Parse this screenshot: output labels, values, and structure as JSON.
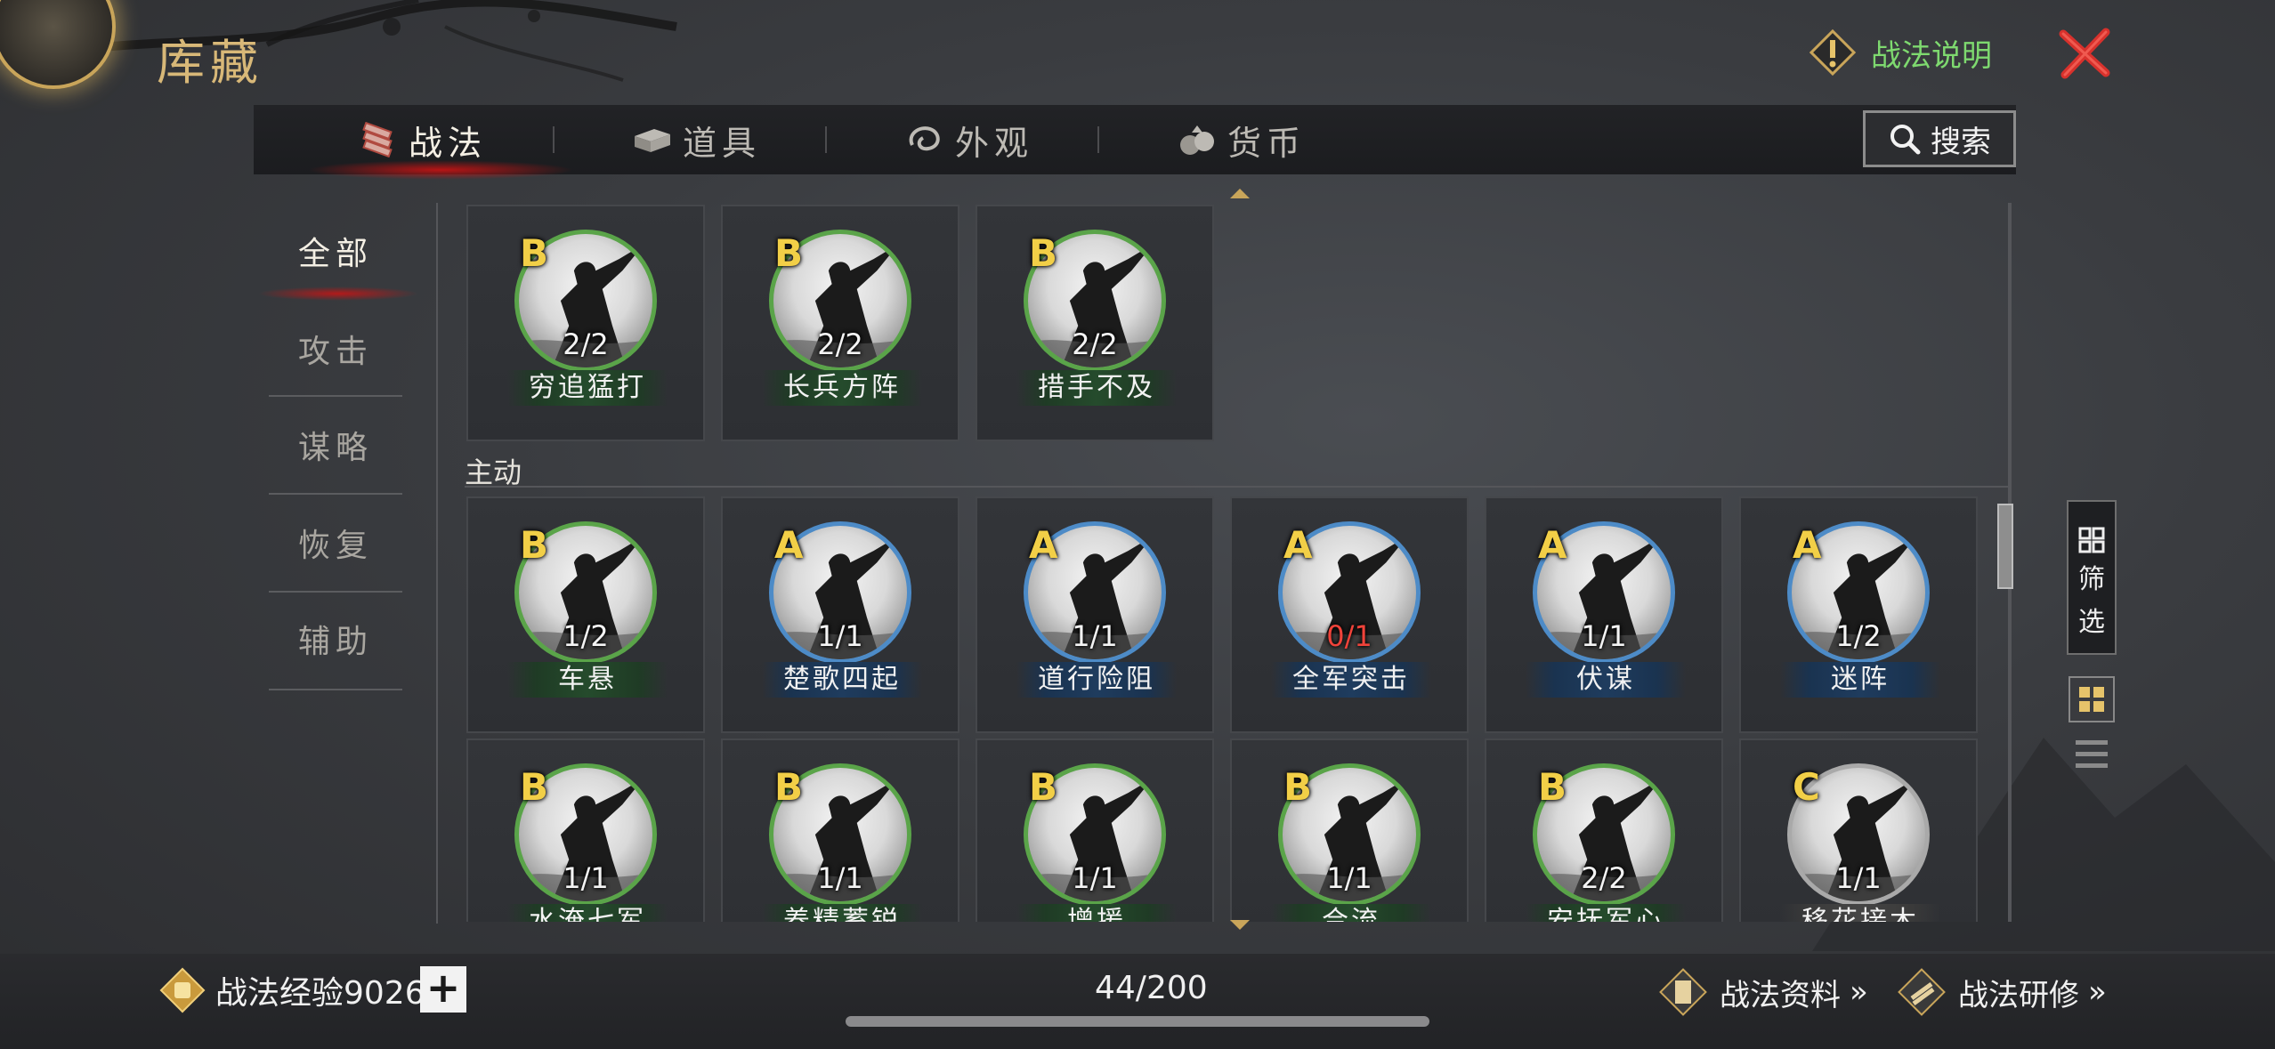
{
  "header": {
    "title": "库藏",
    "help_label": "战法说明",
    "icons": {
      "help": "exclamation-diamond-icon",
      "close": "close-x-icon"
    },
    "accent_green": "#7ed96f",
    "close_color": "#d8312c"
  },
  "tabs": [
    {
      "label": "战法",
      "icon": "tactics-scroll-icon",
      "active": true
    },
    {
      "label": "道具",
      "icon": "item-box-icon",
      "active": false
    },
    {
      "label": "外观",
      "icon": "appearance-swirl-icon",
      "active": false
    },
    {
      "label": "货币",
      "icon": "coin-bag-icon",
      "active": false
    }
  ],
  "search": {
    "label": "搜索",
    "icon": "search-icon"
  },
  "categories": [
    {
      "label": "全部",
      "active": true
    },
    {
      "label": "攻击",
      "active": false
    },
    {
      "label": "谋略",
      "active": false
    },
    {
      "label": "恢复",
      "active": false
    },
    {
      "label": "辅助",
      "active": false
    }
  ],
  "section_active_title": "主动",
  "cards_top": [
    {
      "grade": "B",
      "count": "2/2",
      "name": "穷追猛打",
      "tier": "green"
    },
    {
      "grade": "B",
      "count": "2/2",
      "name": "长兵方阵",
      "tier": "green"
    },
    {
      "grade": "B",
      "count": "2/2",
      "name": "措手不及",
      "tier": "green"
    }
  ],
  "cards_active": [
    {
      "grade": "B",
      "count": "1/2",
      "name": "车悬",
      "tier": "green"
    },
    {
      "grade": "A",
      "count": "1/1",
      "name": "楚歌四起",
      "tier": "blue"
    },
    {
      "grade": "A",
      "count": "1/1",
      "name": "道行险阻",
      "tier": "blue"
    },
    {
      "grade": "A",
      "count": "0/1",
      "name": "全军突击",
      "tier": "blue",
      "count_red": true
    },
    {
      "grade": "A",
      "count": "1/1",
      "name": "伏谋",
      "tier": "blue"
    },
    {
      "grade": "A",
      "count": "1/2",
      "name": "迷阵",
      "tier": "blue"
    },
    {
      "grade": "B",
      "count": "1/1",
      "name": "水淹七军",
      "tier": "green"
    },
    {
      "grade": "B",
      "count": "1/1",
      "name": "养精蓄锐",
      "tier": "green"
    },
    {
      "grade": "B",
      "count": "1/1",
      "name": "增援",
      "tier": "green"
    },
    {
      "grade": "B",
      "count": "1/1",
      "name": "合流",
      "tier": "green"
    },
    {
      "grade": "B",
      "count": "2/2",
      "name": "安抚军心",
      "tier": "green"
    },
    {
      "grade": "C",
      "count": "1/1",
      "name": "移花接木",
      "tier": "grey"
    }
  ],
  "side": {
    "filter_label_1": "筛",
    "filter_label_2": "选",
    "icons": [
      "grid-view-icon",
      "list-view-icon"
    ]
  },
  "bottom": {
    "exp_label": "战法经验9026",
    "plus_label": "+",
    "capacity": "44/200",
    "link1": "战法资料",
    "link2": "战法研修",
    "chevrons": "»"
  }
}
